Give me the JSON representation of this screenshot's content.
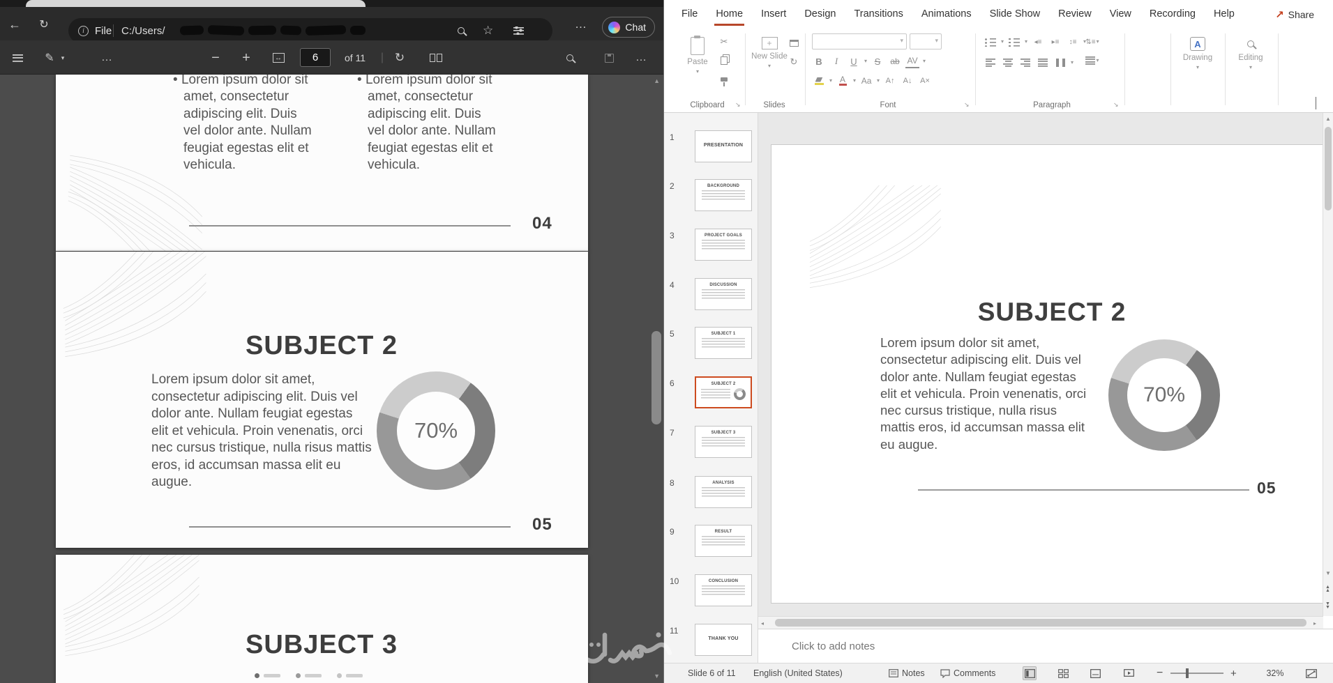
{
  "browser": {
    "address_bar": {
      "file_badge": "File",
      "url_visible": "C:/Users/",
      "chat_button": "Chat"
    },
    "pdf_toolbar": {
      "current_page": "6",
      "page_count": "of 11"
    },
    "pdf_pages": {
      "page_04": {
        "bullet_1": "Lorem ipsum dolor sit amet, consectetur adipiscing elit. Duis vel dolor ante. Nullam feugiat egestas elit et vehicula.",
        "bullet_2": "Lorem ipsum dolor sit amet, consectetur adipiscing elit. Duis vel dolor ante. Nullam feugiat egestas elit et vehicula.",
        "page_label": "04"
      },
      "page_05": {
        "title": "SUBJECT 2",
        "body": "Lorem ipsum dolor sit amet, consectetur adipiscing elit. Duis vel dolor ante. Nullam feugiat egestas elit et vehicula. Proin venenatis, orci nec cursus tristique, nulla risus mattis eros, id accumsan massa elit eu augue.",
        "donut_value": "70%",
        "page_label": "05"
      },
      "page_06": {
        "title": "SUBJECT 3"
      }
    }
  },
  "powerpoint": {
    "menu": [
      "File",
      "Home",
      "Insert",
      "Design",
      "Transitions",
      "Animations",
      "Slide Show",
      "Review",
      "View",
      "Recording",
      "Help"
    ],
    "share_button": "Share",
    "ribbon": {
      "paste": "Paste",
      "new_slide": "New Slide",
      "drawing": "Drawing",
      "editing": "Editing",
      "group_labels": [
        "Clipboard",
        "Slides",
        "Font",
        "Paragraph"
      ]
    },
    "thumbnails": [
      {
        "n": "1",
        "title": "PRESENTATION"
      },
      {
        "n": "2",
        "title": "BACKGROUND"
      },
      {
        "n": "3",
        "title": "PROJECT GOALS"
      },
      {
        "n": "4",
        "title": "DISCUSSION"
      },
      {
        "n": "5",
        "title": "SUBJECT 1"
      },
      {
        "n": "6",
        "title": "SUBJECT 2"
      },
      {
        "n": "7",
        "title": "SUBJECT 3"
      },
      {
        "n": "8",
        "title": "ANALYSIS"
      },
      {
        "n": "9",
        "title": "RESULT"
      },
      {
        "n": "10",
        "title": "CONCLUSION"
      },
      {
        "n": "11",
        "title": "THANK YOU"
      }
    ],
    "slide": {
      "title": "SUBJECT 2",
      "body": "Lorem ipsum dolor sit amet, consectetur adipiscing elit. Duis vel dolor ante. Nullam feugiat egestas elit et vehicula. Proin venenatis, orci nec cursus tristique, nulla risus mattis eros, id accumsan massa elit eu augue.",
      "donut_value": "70%",
      "page_label": "05"
    },
    "notes_placeholder": "Click to add notes",
    "status_bar": {
      "slide_counter": "Slide 6 of 11",
      "language": "English (United States)",
      "notes": "Notes",
      "comments": "Comments",
      "zoom": "32%"
    }
  },
  "icons": {
    "back": "←",
    "refresh": "↻",
    "ellipsis": "…",
    "star": "☆",
    "caret_down": "▾",
    "minus": "−",
    "plus": "+",
    "rotate": "↻",
    "pen": "✎",
    "fit": "↔",
    "cut": "✂",
    "up_arrow": "▲",
    "down_arrow": "▼",
    "left_arrow": "◂",
    "right_arrow": "▸",
    "share": "↗",
    "bold": "B",
    "italic": "I",
    "underline": "U",
    "strike": "S",
    "strike_ab": "ab",
    "kern": "AV",
    "case": "Aa",
    "grow": "A↑",
    "shrink": "A↓",
    "clear": "A×",
    "indent_in": "▸≡",
    "indent_out": "◂≡",
    "spacing": "↕≡",
    "direction": "⇅≡",
    "launcher": "↘"
  },
  "watermark": {
    "text": "خمسات"
  },
  "colors": {
    "ppt_accent": "#c43e1c",
    "selected_slide_border": "#cd4b1f",
    "home_underline": "#b7472a"
  }
}
